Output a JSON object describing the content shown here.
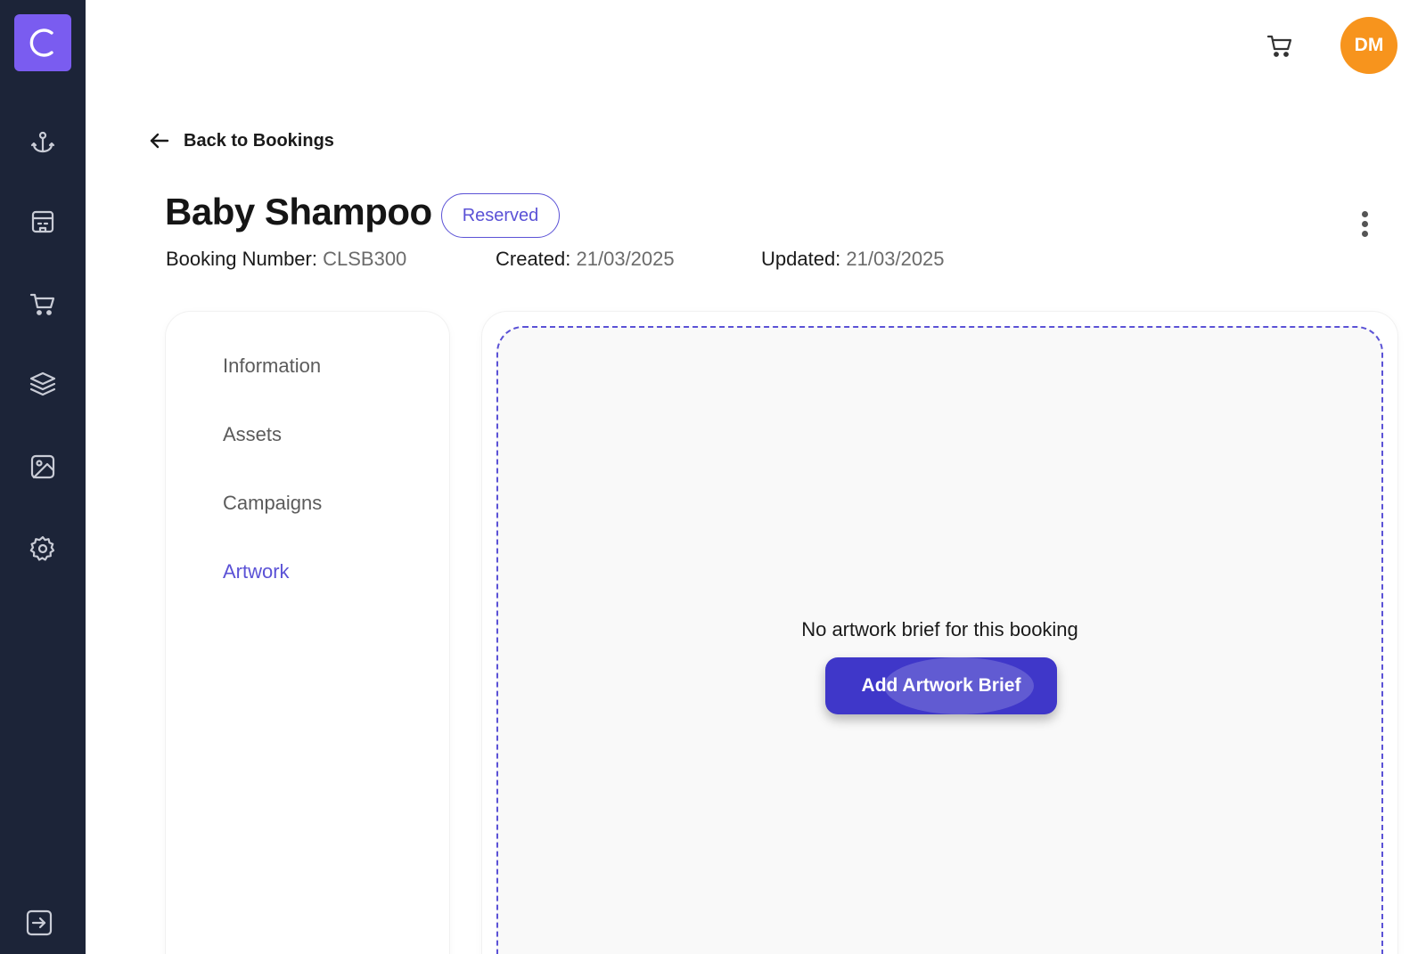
{
  "app": {
    "logo_letter": "C",
    "logo_color": "#7a5cf0",
    "sidebar_color": "#1c2438"
  },
  "sidebar": {
    "items": [
      {
        "icon": "anchor-icon"
      },
      {
        "icon": "building-icon"
      },
      {
        "icon": "cart-icon"
      },
      {
        "icon": "layers-icon"
      },
      {
        "icon": "image-icon"
      },
      {
        "icon": "settings-icon"
      }
    ],
    "bottom_icon": "logout-icon"
  },
  "topbar": {
    "cart_icon": "cart-icon",
    "avatar_initials": "DM",
    "avatar_color": "#f7941d"
  },
  "back_link": {
    "label": "Back to Bookings"
  },
  "booking": {
    "title": "Baby Shampoo",
    "status": "Reserved",
    "number_label": "Booking Number:",
    "number_value": "CLSB300",
    "created_label": "Created:",
    "created_value": "21/03/2025",
    "updated_label": "Updated:",
    "updated_value": "21/03/2025"
  },
  "tabs": [
    {
      "label": "Information",
      "active": false
    },
    {
      "label": "Assets",
      "active": false
    },
    {
      "label": "Campaigns",
      "active": false
    },
    {
      "label": "Artwork",
      "active": true
    }
  ],
  "artwork": {
    "empty_message": "No artwork brief for this booking",
    "add_button": "Add Artwork Brief",
    "accent_color": "#5b52d6",
    "button_color": "#3f37c9"
  }
}
